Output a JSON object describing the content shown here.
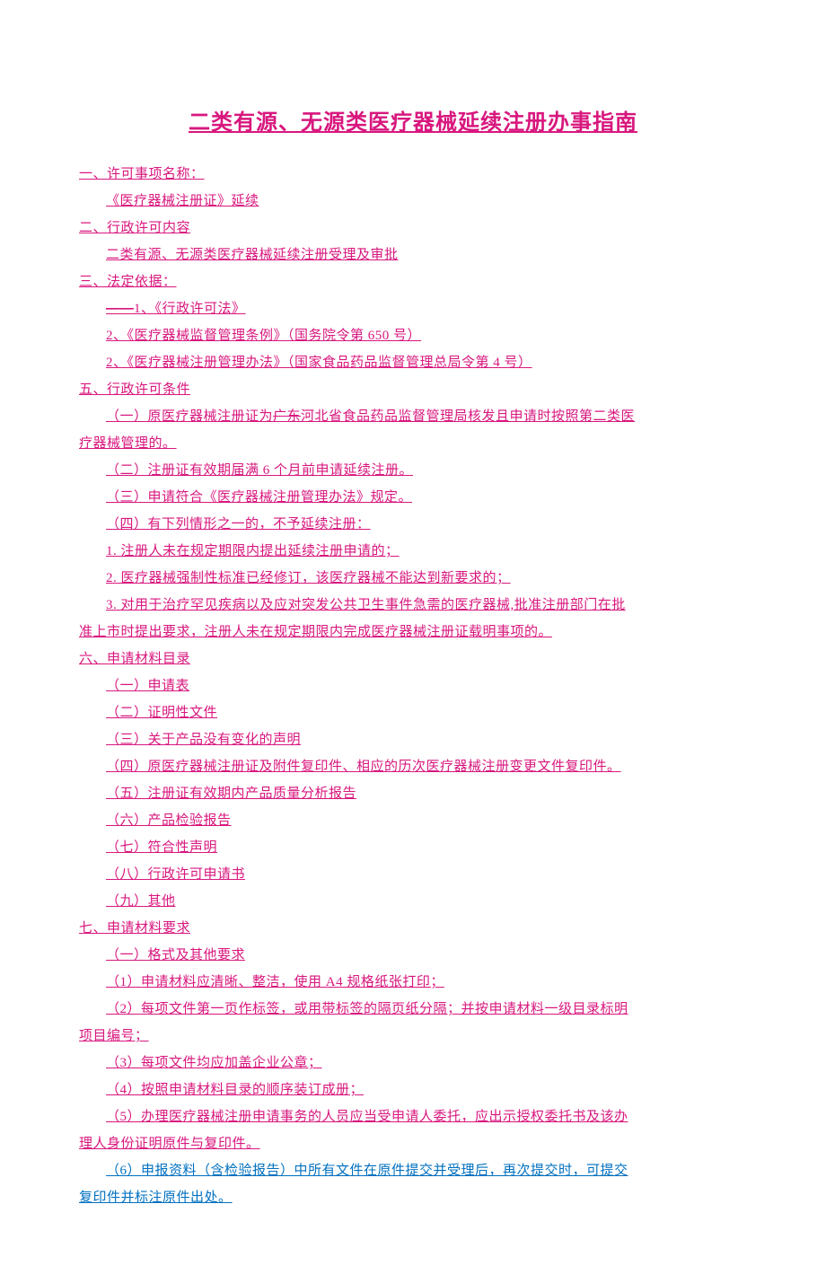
{
  "title": "二类有源、无源类医疗器械延续注册办事指南",
  "s1": {
    "h": "一、许可事项名称：",
    "line": "《医疗器械注册证》延续"
  },
  "s2": {
    "h": "二、行政许可内容",
    "line": "二类有源、无源类医疗器械延续注册受理及审批"
  },
  "s3": {
    "h": "三、法定依据：",
    "l1_prefix": "——",
    "l1_text": "1、《行政许可法》",
    "l2": "2、《医疗器械监督管理条例》（国务院令第 650 号）",
    "l3": "2、《医疗器械注册管理办法》（国家食品药品监督管理总局令第 4 号）"
  },
  "s5": {
    "h": "五、行政许可条件",
    "l1a": "（一）原医疗器械注册证为",
    "l1b_strike": "广东",
    "l1c": "河北省食品药品监督管理局核发且申请时按照第二类医",
    "l1d": "疗器械管理的。",
    "l2": "（二）注册证有效期届满 6 个月前申请延续注册。",
    "l3": "（三）申请符合《医疗器械注册管理办法》规定。",
    "l4": "（四）有下列情形之一的，不予延续注册：",
    "l5": "1. 注册人未在规定期限内提出延续注册申请的；",
    "l6": "2. 医疗器械强制性标准已经修订，该医疗器械不能达到新要求的；",
    "l7a": "3. 对用于治疗罕见疾病以及应对突发公共卫生事件急需的医疗器械,批准注册部门在批",
    "l7b": "准上市时提出要求，注册人未在规定期限内完成医疗器械注册证载明事项的。"
  },
  "s6": {
    "h": "六、申请材料目录",
    "items": [
      "（一）申请表",
      "（二）证明性文件",
      "（三）关于产品没有变化的声明",
      "（四）原医疗器械注册证及附件复印件、相应的历次医疗器械注册变更文件复印件。",
      "（五）注册证有效期内产品质量分析报告",
      "（六）产品检验报告",
      "（七）符合性声明",
      "（八）行政许可申请书",
      "（九）其他"
    ]
  },
  "s7": {
    "h": "七、申请材料要求",
    "l1": "（一）格式及其他要求",
    "l2": "（1）申请材料应清晰、整洁，使用 A4 规格纸张打印；",
    "l3a": "（2）每项文件第一页作标签，或用带标签的隔页纸分隔；并按申请材料一级目录标明",
    "l3b": "项目编号；",
    "l4": "（3）每项文件均应加盖企业公章；",
    "l5": "（4）按照申请材料目录的顺序装订成册；",
    "l6a": "（5）办理医疗器械注册申请事务的人员应当受申请人委托，应出示授权委托书及该办",
    "l6b": "理人身份证明原件与复印件。",
    "l7a": "（6）申报资料（含检验报告）中所有文件在原件提交并受理后，再次提交时，可提交",
    "l7b": "复印件并标注原件出处。"
  }
}
